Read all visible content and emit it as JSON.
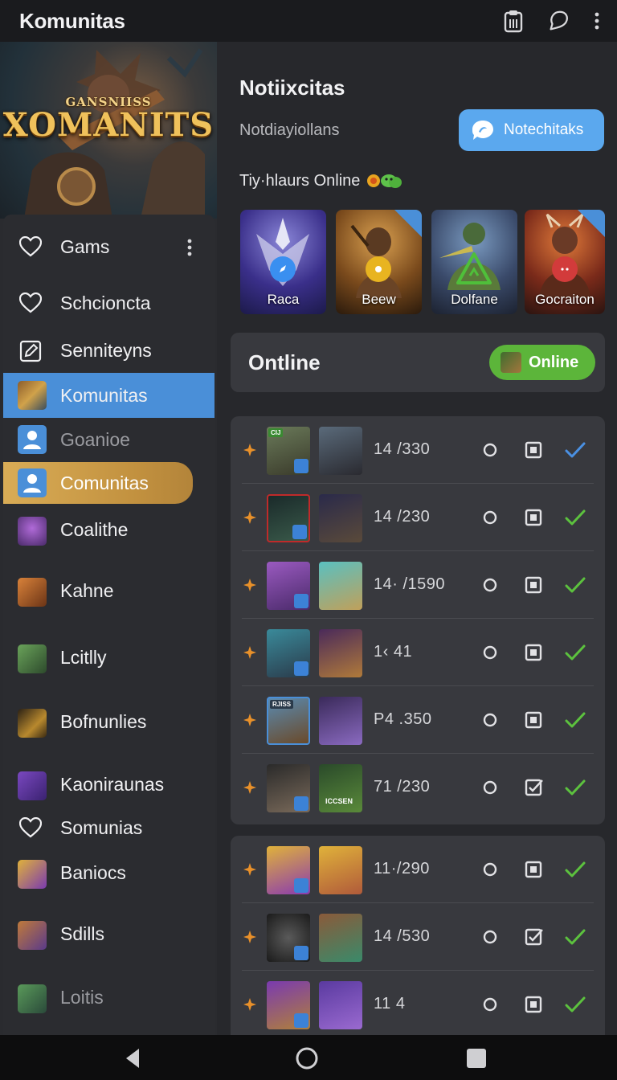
{
  "app_bar": {
    "title": "Komunitas",
    "icons": [
      "clipboard-icon",
      "chat-bubble-icon",
      "more-vert-icon"
    ]
  },
  "sidebar": {
    "banner": {
      "subtitle": "GANSNIISS",
      "logo_text": "XOMANITS"
    },
    "items": [
      {
        "label": "Gams",
        "icon": "heart-icon",
        "state": "normal"
      },
      {
        "label": "Schcioncta",
        "icon": "heart-icon",
        "state": "normal"
      },
      {
        "label": "Senniteyns",
        "icon": "edit-box-icon",
        "state": "normal"
      },
      {
        "label": "Komunitas",
        "icon": "game-avatar",
        "state": "active"
      },
      {
        "label": "Goanioe",
        "icon": "user-icon",
        "state": "dim"
      },
      {
        "label": "Comunitas",
        "icon": "user-icon",
        "state": "highlight"
      },
      {
        "label": "Coalithe",
        "icon": "game-avatar",
        "state": "normal"
      },
      {
        "label": "Kahne",
        "icon": "game-avatar",
        "state": "normal"
      },
      {
        "label": "Lcitlly",
        "icon": "game-avatar",
        "state": "normal"
      },
      {
        "label": "Bofnunlies",
        "icon": "game-avatar",
        "state": "normal"
      },
      {
        "label": "Kaoniraunas",
        "icon": "game-avatar",
        "state": "normal"
      },
      {
        "label": "Somunias",
        "icon": "heart-icon",
        "state": "normal"
      },
      {
        "label": "Baniocs",
        "icon": "game-avatar",
        "state": "normal"
      },
      {
        "label": "Sdills",
        "icon": "game-avatar",
        "state": "normal"
      },
      {
        "label": "Loitis",
        "icon": "game-avatar",
        "state": "dim"
      }
    ]
  },
  "notifications": {
    "title": "Notiixcitas",
    "subtitle": "Notdiayiollans",
    "button_label": "Notechitaks",
    "online_label": "Tiy·hlaurs Online"
  },
  "games": [
    {
      "name": "Raca",
      "dot_color": "#3a8ff0"
    },
    {
      "name": "Beew",
      "dot_color": "#e8b420"
    },
    {
      "name": "Dolfane",
      "dot_color": "#4fbf3a"
    },
    {
      "name": "Gocraiton",
      "dot_color": "#d23b3b"
    }
  ],
  "online_section": {
    "title": "Ontline",
    "pill_label": "Online"
  },
  "players": [
    {
      "count": "14 /330",
      "check_color": "#4a90e2"
    },
    {
      "count": "14 /230",
      "check_color": "#5cc23e"
    },
    {
      "count": "14· /1590",
      "check_color": "#5cc23e"
    },
    {
      "count": "1‹ 41",
      "check_color": "#5cc23e"
    },
    {
      "count": "P4 .350",
      "check_color": "#5cc23e"
    },
    {
      "count": "71 /230",
      "check_color": "#5cc23e"
    },
    {
      "count": "11·/290",
      "check_color": "#5cc23e"
    },
    {
      "count": "14 /530",
      "check_color": "#5cc23e"
    },
    {
      "count": "11 4",
      "check_color": "#5cc23e"
    }
  ],
  "player_tags": {
    "row1": "CIJ",
    "row5": "RJISS",
    "row6_name": "ICCSEN"
  },
  "system_nav": [
    "back-icon",
    "home-icon",
    "recents-icon"
  ]
}
